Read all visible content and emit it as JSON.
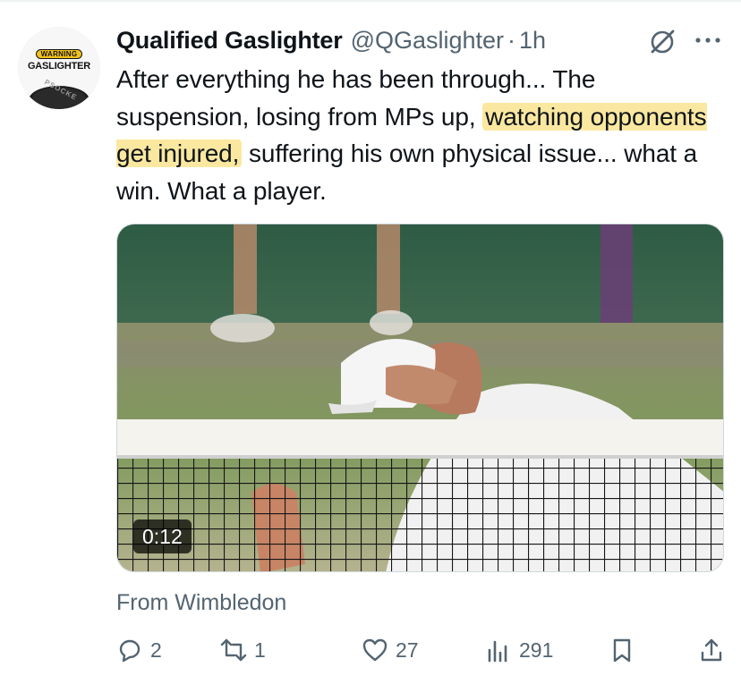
{
  "tweet": {
    "author_name": "Qualified Gaslighter",
    "handle": "@QGaslighter",
    "separator": "·",
    "time": "1h",
    "text_parts": [
      "After everything he has been through... The suspension, losing from MPs up, ",
      "watching opponents get injured,",
      " suffering his own physical issue... what a win. What a player."
    ],
    "highlight_color": "#fbe8a0"
  },
  "avatar": {
    "warning": "WARNING",
    "name": "GASLIGHTER",
    "grip_text": "PSOCKE",
    "badge_color": "#f2c21b"
  },
  "media": {
    "type": "video",
    "duration": "0:12"
  },
  "source": {
    "label": "From Wimbledon"
  },
  "actions": {
    "replies": "2",
    "reposts": "1",
    "likes": "27",
    "views": "291"
  },
  "icons": [
    "grok-icon",
    "more-icon",
    "reply-icon",
    "repost-icon",
    "like-icon",
    "views-icon",
    "bookmark-icon",
    "share-icon"
  ],
  "colors": {
    "text": "#0f1419",
    "secondary": "#536471",
    "border": "#cfd9de"
  }
}
